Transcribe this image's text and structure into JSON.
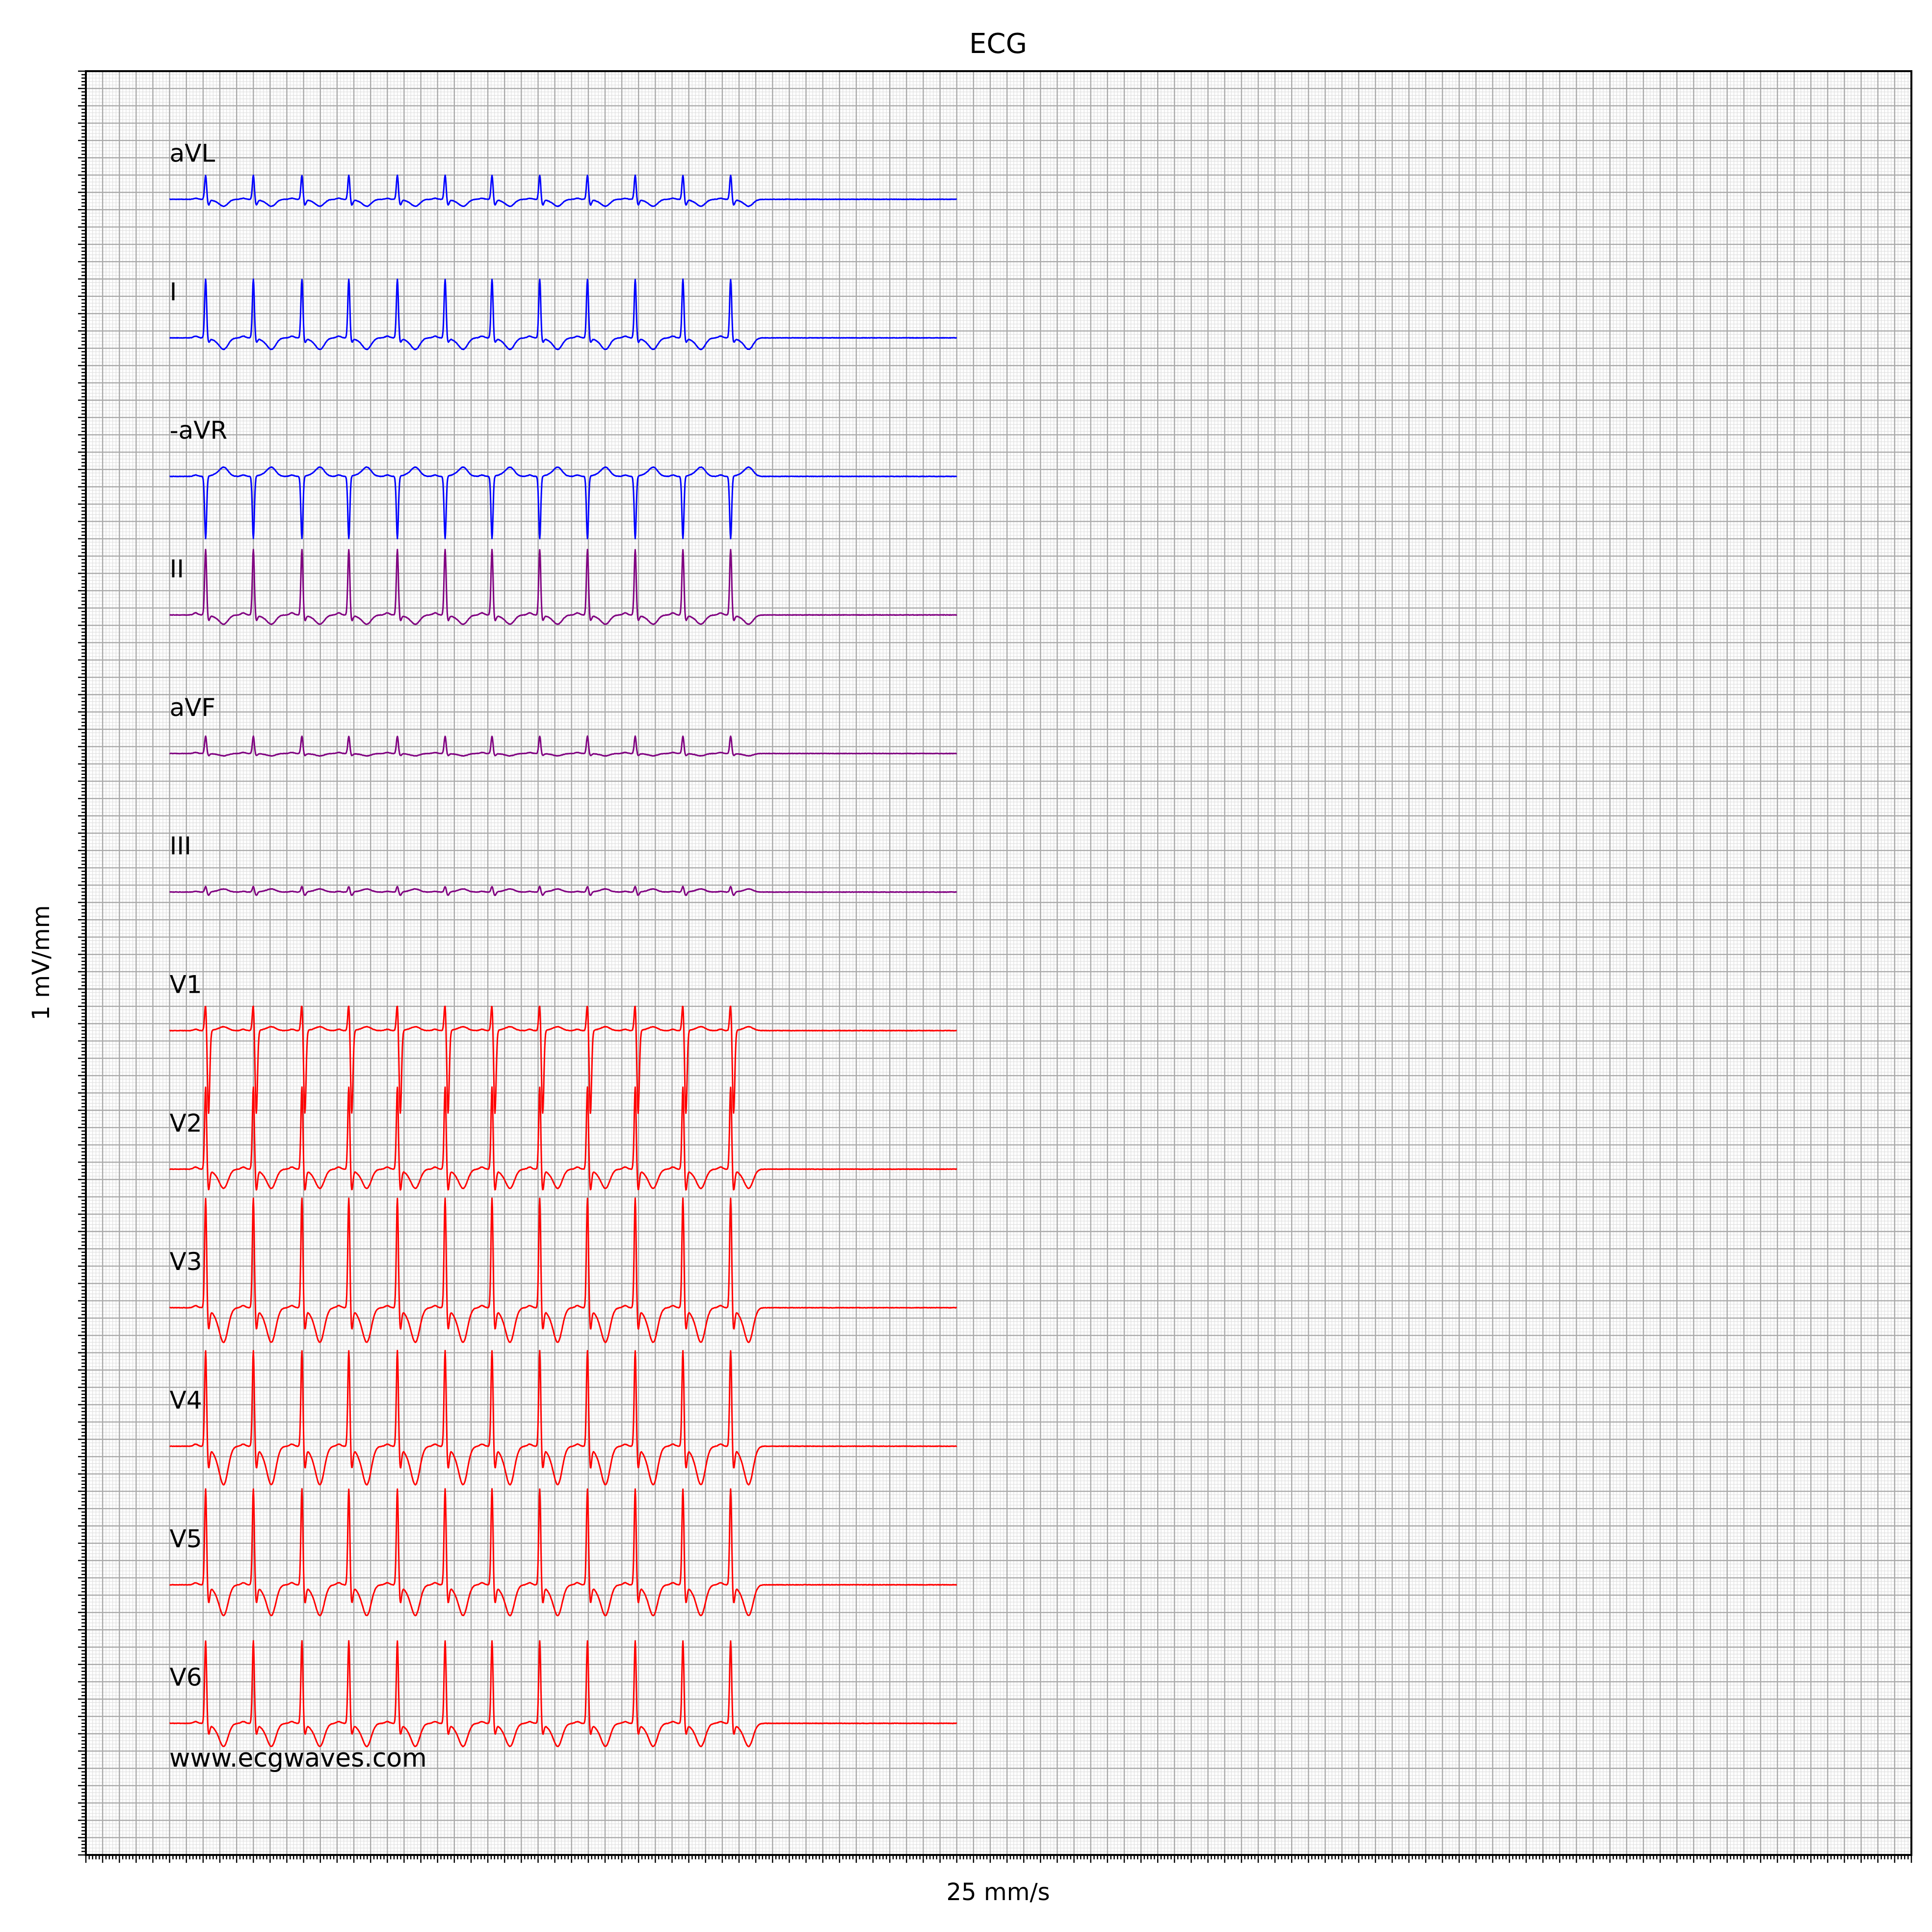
{
  "chart_data": {
    "type": "line",
    "title": "ECG",
    "xlabel": "25 mm/s",
    "ylabel": "1 mV/mm",
    "grid": true,
    "watermark": "www.ecgwaves.com",
    "colors": {
      "limb_lateral": "#0000ff",
      "limb_inferior": "#800080",
      "precordial": "#ff0000",
      "grid_major": "#a9a9a9",
      "grid_minor": "#e0e0e0"
    },
    "sample_rate_hz": 200,
    "duration_s": 10,
    "beats_s": [
      0.43,
      1.0,
      1.58,
      2.14,
      2.72,
      3.29,
      3.85,
      4.42,
      4.99,
      5.56,
      6.13,
      6.7
    ],
    "series": [
      {
        "name": "aVL",
        "color": "#0000ff",
        "baseline_mm": -42,
        "r_mv": 3.5,
        "s_mv": -0.8,
        "t_mv": -0.9,
        "p_mv": 0.15
      },
      {
        "name": "I",
        "color": "#0000ff",
        "baseline_mm": -82,
        "r_mv": 8.5,
        "s_mv": -0.6,
        "t_mv": -1.5,
        "p_mv": 0.25
      },
      {
        "name": "-aVR",
        "color": "#0000ff",
        "baseline_mm": -122,
        "r_mv": -9.0,
        "s_mv": 0.0,
        "t_mv": 1.2,
        "p_mv": 0.2
      },
      {
        "name": "II",
        "color": "#800080",
        "baseline_mm": -162,
        "r_mv": 9.5,
        "s_mv": -0.8,
        "t_mv": -1.2,
        "p_mv": 0.3
      },
      {
        "name": "aVF",
        "color": "#800080",
        "baseline_mm": -202,
        "r_mv": 2.5,
        "s_mv": -0.3,
        "t_mv": -0.3,
        "p_mv": 0.15
      },
      {
        "name": "III",
        "color": "#800080",
        "baseline_mm": -242,
        "r_mv": 0.8,
        "s_mv": -0.5,
        "t_mv": 0.4,
        "p_mv": 0.1
      },
      {
        "name": "V1",
        "color": "#ff0000",
        "baseline_mm": -282,
        "r_mv": 4.0,
        "s_mv": -12.0,
        "t_mv": 0.5,
        "p_mv": 0.2
      },
      {
        "name": "V2",
        "color": "#ff0000",
        "baseline_mm": -322,
        "r_mv": 12.0,
        "s_mv": -3.0,
        "t_mv": -2.5,
        "p_mv": 0.3
      },
      {
        "name": "V3",
        "color": "#ff0000",
        "baseline_mm": -362,
        "r_mv": 16.0,
        "s_mv": -3.0,
        "t_mv": -4.5,
        "p_mv": 0.3
      },
      {
        "name": "V4",
        "color": "#ff0000",
        "baseline_mm": -402,
        "r_mv": 14.0,
        "s_mv": -3.0,
        "t_mv": -5.0,
        "p_mv": 0.3
      },
      {
        "name": "V5",
        "color": "#ff0000",
        "baseline_mm": -442,
        "r_mv": 14.0,
        "s_mv": -2.5,
        "t_mv": -4.0,
        "p_mv": 0.3
      },
      {
        "name": "V6",
        "color": "#ff0000",
        "baseline_mm": -482,
        "r_mv": 12.0,
        "s_mv": -1.5,
        "t_mv": -3.0,
        "p_mv": 0.25
      }
    ],
    "xlim_mm": [
      -25,
      520
    ],
    "ylim_mm": [
      -520,
      -5
    ]
  }
}
